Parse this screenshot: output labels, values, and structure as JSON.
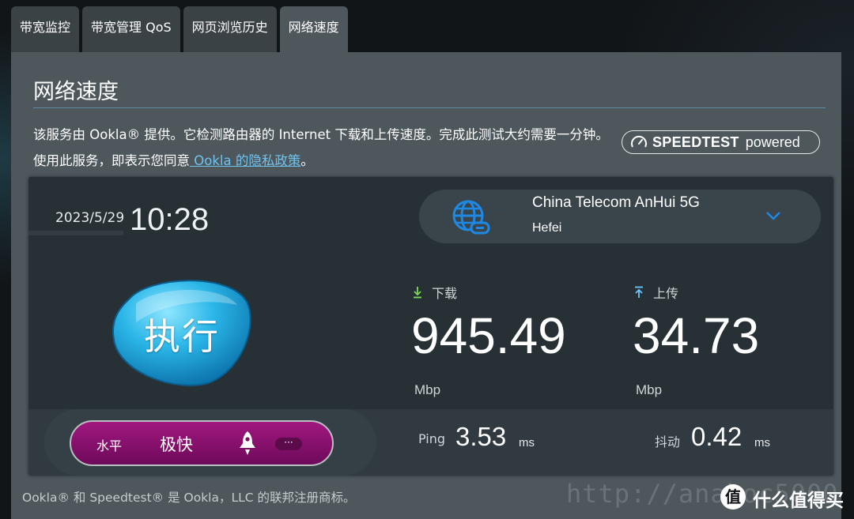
{
  "tabs": [
    {
      "label": "带宽监控"
    },
    {
      "label": "带宽管理 QoS"
    },
    {
      "label": "网页浏览历史"
    },
    {
      "label": "网络速度"
    }
  ],
  "panel": {
    "title": "网络速度",
    "description_part1": "该服务由 Ookla® 提供。它检测路由器的 Internet 下载和上传速度。完成此测试大约需要一分钟。使用此服务，即表示您同意",
    "privacy_link": " Ookla 的隐私政策",
    "description_end": "。",
    "badge_brand": "SPEEDTEST",
    "badge_powered": "powered"
  },
  "test": {
    "date": "2023/5/29",
    "time": "10:28",
    "server_name": "China Telecom AnHui 5G",
    "server_city": "Hefei",
    "go_label": "执行",
    "download_label": "下载",
    "download_value": "945.49",
    "download_unit": "Mbp",
    "upload_label": "上传",
    "upload_value": "34.73",
    "upload_unit": "Mbp",
    "level_key": "水平",
    "level_value": "极快",
    "more_label": "···",
    "ping_label": "Ping",
    "ping_value": "3.53",
    "ping_unit": "ms",
    "jitter_label": "抖动",
    "jitter_value": "0.42",
    "jitter_unit": "ms"
  },
  "footer": {
    "trademark": "Ookla® 和 Speedtest® 是 Ookla，LLC 的联邦注册商标。"
  },
  "watermark": {
    "url": "http://anahoc5000",
    "logo_char": "值",
    "site_name": "什么值得买"
  },
  "colors": {
    "accent_blue": "#1e88e5",
    "download_arrow": "#7ed957",
    "upload_arrow": "#6ec6ff",
    "level_pill": "#8e1173"
  }
}
